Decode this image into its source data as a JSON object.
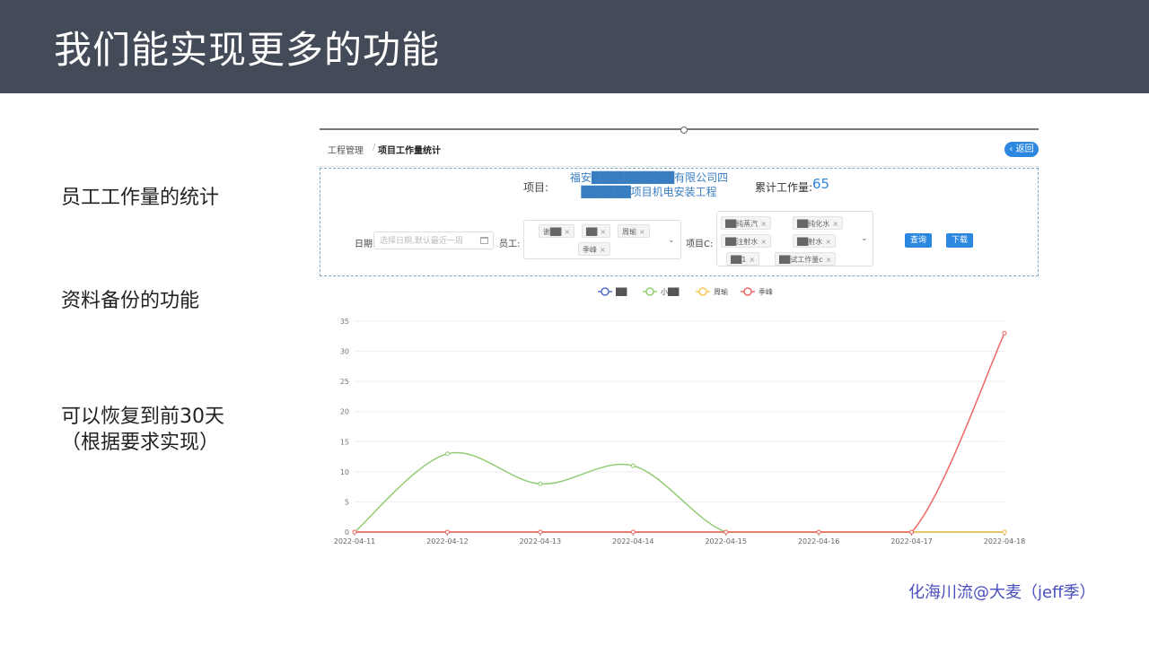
{
  "slide": {
    "title": "我们能实现更多的功能",
    "bullets": [
      "员工工作量的统计",
      "资料备份的功能",
      "可以恢复到前30天",
      "（根据要求实现）"
    ],
    "credit": "化海川流@大麦（jeff季）"
  },
  "app": {
    "breadcrumb": [
      "工程管理",
      "/",
      "项目工作量统计"
    ],
    "back_label": "‹ 返回",
    "project_label": "项目:",
    "project_name_line1": "福安██████████有限公司四",
    "project_name_line2": "██████项目机电安装工程",
    "total_label": "累计工作量:",
    "total_value": "65",
    "date_label": "日期:",
    "date_placeholder": "选择日期,默认最近一周",
    "employee_label": "员工:",
    "employee_tags": [
      "谢██",
      "██",
      "周瑜",
      "季峰"
    ],
    "project_c_label": "项目C:",
    "project_tags": [
      "██纯蒸汽",
      "██纯化水",
      "██注射水",
      "██射水",
      "██1",
      "██试工作量c"
    ],
    "query_button": "查询",
    "download_button": "下载",
    "colors": {
      "accent": "#2b87e0",
      "banner": "#444b58"
    }
  },
  "chart_data": {
    "type": "line",
    "x": [
      "2022-04-11",
      "2022-04-12",
      "2022-04-13",
      "2022-04-14",
      "2022-04-15",
      "2022-04-16",
      "2022-04-17",
      "2022-04-18"
    ],
    "ylim": [
      0,
      35
    ],
    "yticks": [
      0,
      5,
      10,
      15,
      20,
      25,
      30,
      35
    ],
    "legend_position": "top-center",
    "grid": true,
    "series": [
      {
        "name": "██",
        "color": "#5470c6",
        "values": [
          0,
          0,
          0,
          0,
          0,
          0,
          0,
          0
        ]
      },
      {
        "name": "小██",
        "color": "#91cc75",
        "values": [
          0,
          13,
          8,
          11,
          0,
          0,
          0,
          0
        ]
      },
      {
        "name": "周瑜",
        "color": "#fac858",
        "values": [
          0,
          0,
          0,
          0,
          0,
          0,
          0,
          0
        ]
      },
      {
        "name": "季峰",
        "color": "#ee6666",
        "values": [
          0,
          0,
          0,
          0,
          0,
          0,
          0,
          33
        ]
      }
    ]
  }
}
